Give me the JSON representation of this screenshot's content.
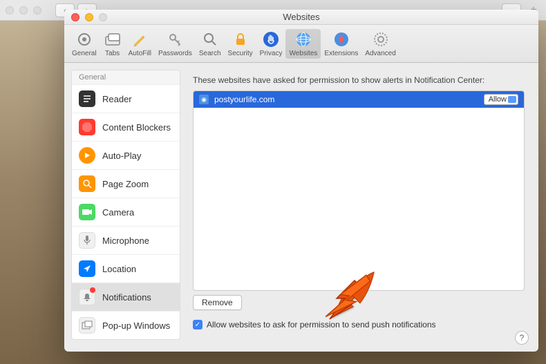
{
  "outer_chrome": {},
  "modal": {
    "title": "Websites",
    "toolbar": [
      {
        "label": "General",
        "icon": "gear"
      },
      {
        "label": "Tabs",
        "icon": "tabs"
      },
      {
        "label": "AutoFill",
        "icon": "pencil"
      },
      {
        "label": "Passwords",
        "icon": "key"
      },
      {
        "label": "Search",
        "icon": "search"
      },
      {
        "label": "Security",
        "icon": "lock"
      },
      {
        "label": "Privacy",
        "icon": "hand"
      },
      {
        "label": "Websites",
        "icon": "globe"
      },
      {
        "label": "Extensions",
        "icon": "compass"
      },
      {
        "label": "Advanced",
        "icon": "cog"
      }
    ]
  },
  "sidebar": {
    "header": "General",
    "items": [
      {
        "label": "Reader",
        "color": "#333",
        "icon": "reader"
      },
      {
        "label": "Content Blockers",
        "color": "#ff3b30",
        "icon": "stop"
      },
      {
        "label": "Auto-Play",
        "color": "#ff9500",
        "icon": "play"
      },
      {
        "label": "Page Zoom",
        "color": "#ff9500",
        "icon": "zoom"
      },
      {
        "label": "Camera",
        "color": "#4cd964",
        "icon": "camera"
      },
      {
        "label": "Microphone",
        "color": "#e8e8e8",
        "icon": "mic"
      },
      {
        "label": "Location",
        "color": "#007aff",
        "icon": "location"
      },
      {
        "label": "Notifications",
        "color": "#e8e8e8",
        "icon": "notif",
        "selected": true,
        "badge": true
      },
      {
        "label": "Pop-up Windows",
        "color": "#e8e8e8",
        "icon": "popup"
      }
    ]
  },
  "main": {
    "description": "These websites have asked for permission to show alerts in Notification Center:",
    "rows": [
      {
        "domain": "postyourlife.com",
        "permission": "Allow"
      }
    ],
    "remove_label": "Remove",
    "checkbox_label": "Allow websites to ask for permission to send push notifications",
    "checkbox_checked": true
  },
  "help": "?"
}
